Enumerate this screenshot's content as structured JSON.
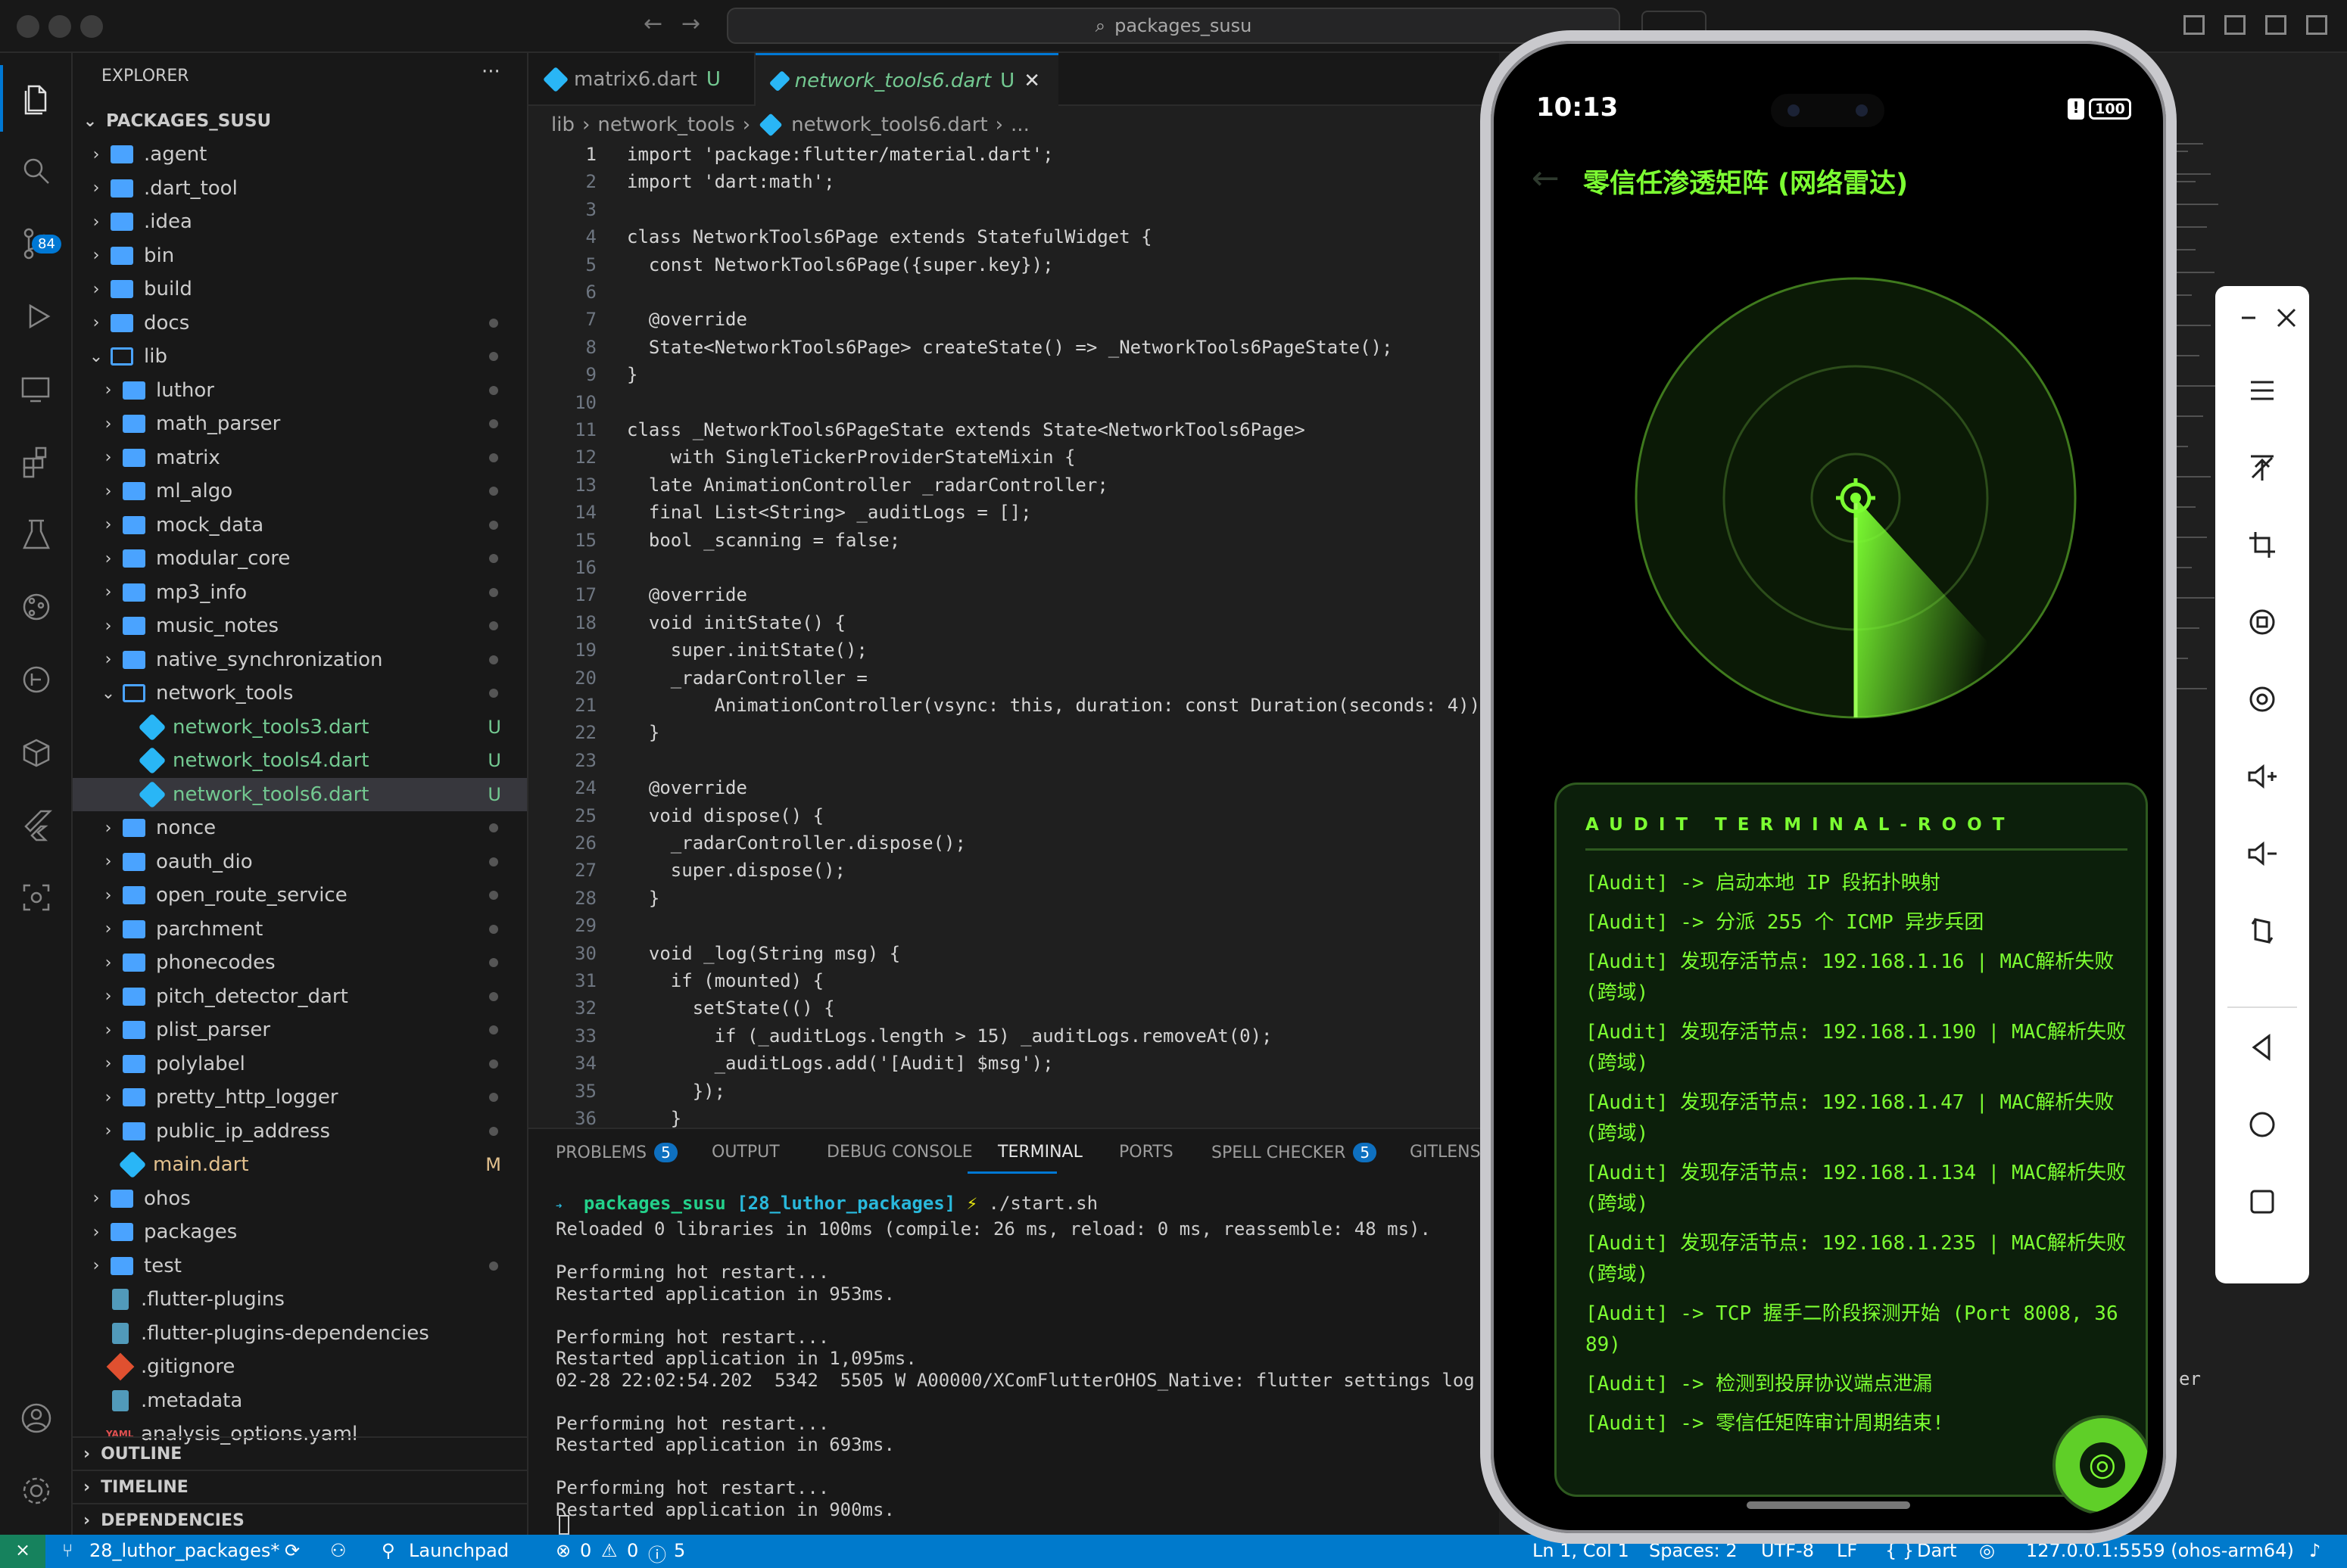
{
  "window": {
    "title": "packages_susu"
  },
  "activity": {
    "scm_badge": "84"
  },
  "explorer": {
    "header": "EXPLORER",
    "more": "···",
    "root": "PACKAGES_SUSU",
    "items": [
      {
        "label": ".agent",
        "kind": "folder",
        "indent": 1,
        "chev": "›"
      },
      {
        "label": ".dart_tool",
        "kind": "folder",
        "indent": 1,
        "chev": "›"
      },
      {
        "label": ".idea",
        "kind": "folder",
        "indent": 1,
        "chev": "›"
      },
      {
        "label": "bin",
        "kind": "folder",
        "indent": 1,
        "chev": "›"
      },
      {
        "label": "build",
        "kind": "folder",
        "indent": 1,
        "chev": "›"
      },
      {
        "label": "docs",
        "kind": "folder",
        "indent": 1,
        "chev": "›",
        "dot": true
      },
      {
        "label": "lib",
        "kind": "open",
        "indent": 1,
        "chev": "⌄",
        "dot": true
      },
      {
        "label": "luthor",
        "kind": "folder",
        "indent": 2,
        "chev": "›",
        "dot": true
      },
      {
        "label": "math_parser",
        "kind": "folder",
        "indent": 2,
        "chev": "›",
        "dot": true
      },
      {
        "label": "matrix",
        "kind": "folder",
        "indent": 2,
        "chev": "›",
        "dot": true
      },
      {
        "label": "ml_algo",
        "kind": "folder",
        "indent": 2,
        "chev": "›",
        "dot": true
      },
      {
        "label": "mock_data",
        "kind": "folder",
        "indent": 2,
        "chev": "›",
        "dot": true
      },
      {
        "label": "modular_core",
        "kind": "folder",
        "indent": 2,
        "chev": "›",
        "dot": true
      },
      {
        "label": "mp3_info",
        "kind": "folder",
        "indent": 2,
        "chev": "›",
        "dot": true
      },
      {
        "label": "music_notes",
        "kind": "folder",
        "indent": 2,
        "chev": "›",
        "dot": true
      },
      {
        "label": "native_synchronization",
        "kind": "folder",
        "indent": 2,
        "chev": "›",
        "dot": true
      },
      {
        "label": "network_tools",
        "kind": "open",
        "indent": 2,
        "chev": "⌄",
        "dot": true
      },
      {
        "label": "network_tools3.dart",
        "kind": "dart",
        "indent": 3,
        "badge": "U"
      },
      {
        "label": "network_tools4.dart",
        "kind": "dart",
        "indent": 3,
        "badge": "U"
      },
      {
        "label": "network_tools6.dart",
        "kind": "dart",
        "indent": 3,
        "badge": "U",
        "selected": true
      },
      {
        "label": "nonce",
        "kind": "folder",
        "indent": 2,
        "chev": "›",
        "dot": true
      },
      {
        "label": "oauth_dio",
        "kind": "folder",
        "indent": 2,
        "chev": "›",
        "dot": true
      },
      {
        "label": "open_route_service",
        "kind": "folder",
        "indent": 2,
        "chev": "›",
        "dot": true
      },
      {
        "label": "parchment",
        "kind": "folder",
        "indent": 2,
        "chev": "›",
        "dot": true
      },
      {
        "label": "phonecodes",
        "kind": "folder",
        "indent": 2,
        "chev": "›",
        "dot": true
      },
      {
        "label": "pitch_detector_dart",
        "kind": "folder",
        "indent": 2,
        "chev": "›",
        "dot": true
      },
      {
        "label": "plist_parser",
        "kind": "folder",
        "indent": 2,
        "chev": "›",
        "dot": true
      },
      {
        "label": "polylabel",
        "kind": "folder",
        "indent": 2,
        "chev": "›",
        "dot": true
      },
      {
        "label": "pretty_http_logger",
        "kind": "folder",
        "indent": 2,
        "chev": "›",
        "dot": true
      },
      {
        "label": "public_ip_address",
        "kind": "folder",
        "indent": 2,
        "chev": "›",
        "dot": true
      },
      {
        "label": "main.dart",
        "kind": "dart",
        "indent": 2,
        "badge": "M"
      },
      {
        "label": "ohos",
        "kind": "folder",
        "indent": 1,
        "chev": "›"
      },
      {
        "label": "packages",
        "kind": "folder",
        "indent": 1,
        "chev": "›"
      },
      {
        "label": "test",
        "kind": "folder",
        "indent": 1,
        "chev": "›",
        "dot": true
      },
      {
        "label": ".flutter-plugins",
        "kind": "file",
        "indent": 1
      },
      {
        "label": ".flutter-plugins-dependencies",
        "kind": "file",
        "indent": 1
      },
      {
        "label": ".gitignore",
        "kind": "git",
        "indent": 1
      },
      {
        "label": ".metadata",
        "kind": "file",
        "indent": 1
      },
      {
        "label": "analysis_options.yaml",
        "kind": "yaml",
        "indent": 1,
        "yamltag": "YAML"
      }
    ],
    "sections": [
      "OUTLINE",
      "TIMELINE",
      "DEPENDENCIES"
    ]
  },
  "editor": {
    "tabs": [
      {
        "label": "matrix6.dart",
        "badge": "U"
      },
      {
        "label": "network_tools6.dart",
        "badge": "U",
        "close": "✕"
      }
    ],
    "breadcrumb": [
      "lib",
      "network_tools",
      "network_tools6.dart",
      "..."
    ],
    "lines": [
      "import 'package:flutter/material.dart';",
      "import 'dart:math';",
      "",
      "class NetworkTools6Page extends StatefulWidget {",
      "  const NetworkTools6Page({super.key});",
      "",
      "  @override",
      "  State<NetworkTools6Page> createState() => _NetworkTools6PageState();",
      "}",
      "",
      "class _NetworkTools6PageState extends State<NetworkTools6Page>",
      "    with SingleTickerProviderStateMixin {",
      "  late AnimationController _radarController;",
      "  final List<String> _auditLogs = [];",
      "  bool _scanning = false;",
      "",
      "  @override",
      "  void initState() {",
      "    super.initState();",
      "    _radarController =",
      "        AnimationController(vsync: this, duration: const Duration(seconds: 4))",
      "  }",
      "",
      "  @override",
      "  void dispose() {",
      "    _radarController.dispose();",
      "    super.dispose();",
      "  }",
      "",
      "  void _log(String msg) {",
      "    if (mounted) {",
      "      setState(() {",
      "        if (_auditLogs.length > 15) _auditLogs.removeAt(0);",
      "        _auditLogs.add('[Audit] $msg');",
      "      });",
      "    }"
    ]
  },
  "panel": {
    "tabs": [
      {
        "label": "PROBLEMS",
        "badge": "5"
      },
      {
        "label": "OUTPUT"
      },
      {
        "label": "DEBUG CONSOLE"
      },
      {
        "label": "TERMINAL",
        "active": true
      },
      {
        "label": "PORTS"
      },
      {
        "label": "SPELL CHECKER",
        "badge": "5"
      },
      {
        "label": "GITLENS"
      }
    ],
    "prompt_arrow": "➜",
    "prompt_dir": "packages_susu",
    "prompt_branch": "[28_luthor_packages]",
    "prompt_bolt": "⚡",
    "prompt_cmd": "./start.sh",
    "output": "Reloaded 0 libraries in 100ms (compile: 26 ms, reload: 0 ms, reassemble: 48 ms).\n\nPerforming hot restart...\nRestarted application in 953ms.\n\nPerforming hot restart...\nRestarted application in 1,095ms.\n02-28 22:02:54.202  5342  5505 W A00000/XComFlutterOHOS_Native: flutter settings log me\n\nPerforming hot restart...\nRestarted application in 693ms.\n\nPerforming hot restart...\nRestarted application in 900ms.",
    "overflow_char": "er"
  },
  "status": {
    "branch": "28_luthor_packages*",
    "launchpad": "Launchpad",
    "errors": "0",
    "warnings": "0",
    "infos": "5",
    "position": "Ln 1, Col 1",
    "spaces": "Spaces: 2",
    "encoding": "UTF-8",
    "eol": "LF",
    "lang": "Dart",
    "device": "127.0.0.1:5559 (ohos-arm64)"
  },
  "phone": {
    "time": "10:13",
    "alert": "!",
    "battery": "100",
    "back": "←",
    "title": "零信任渗透矩阵 (网络雷达)",
    "terminal_title": "AUDIT TERMINAL-ROOT",
    "logs": [
      "[Audit] -> 启动本地 IP 段拓扑映射",
      "[Audit] -> 分派 255 个 ICMP 异步兵团",
      "[Audit] 发现存活节点: 192.168.1.16 | MAC解析失败(跨域)",
      "[Audit] 发现存活节点: 192.168.1.190 | MAC解析失败(跨域)",
      "[Audit] 发现存活节点: 192.168.1.47 | MAC解析失败(跨域)",
      "[Audit] 发现存活节点: 192.168.1.134 | MAC解析失败(跨域)",
      "[Audit] 发现存活节点: 192.168.1.235 | MAC解析失败(跨域)",
      "[Audit] -> TCP 握手二阶段探测开始 (Port 8008, 3689)",
      "[Audit] -> 检测到投屏协议端点泄漏",
      "[Audit] -> 零信任矩阵审计周期结束!"
    ],
    "colors": {
      "accent": "#7cff32",
      "bg": "#000000",
      "panel": "#0c1f0b"
    }
  }
}
